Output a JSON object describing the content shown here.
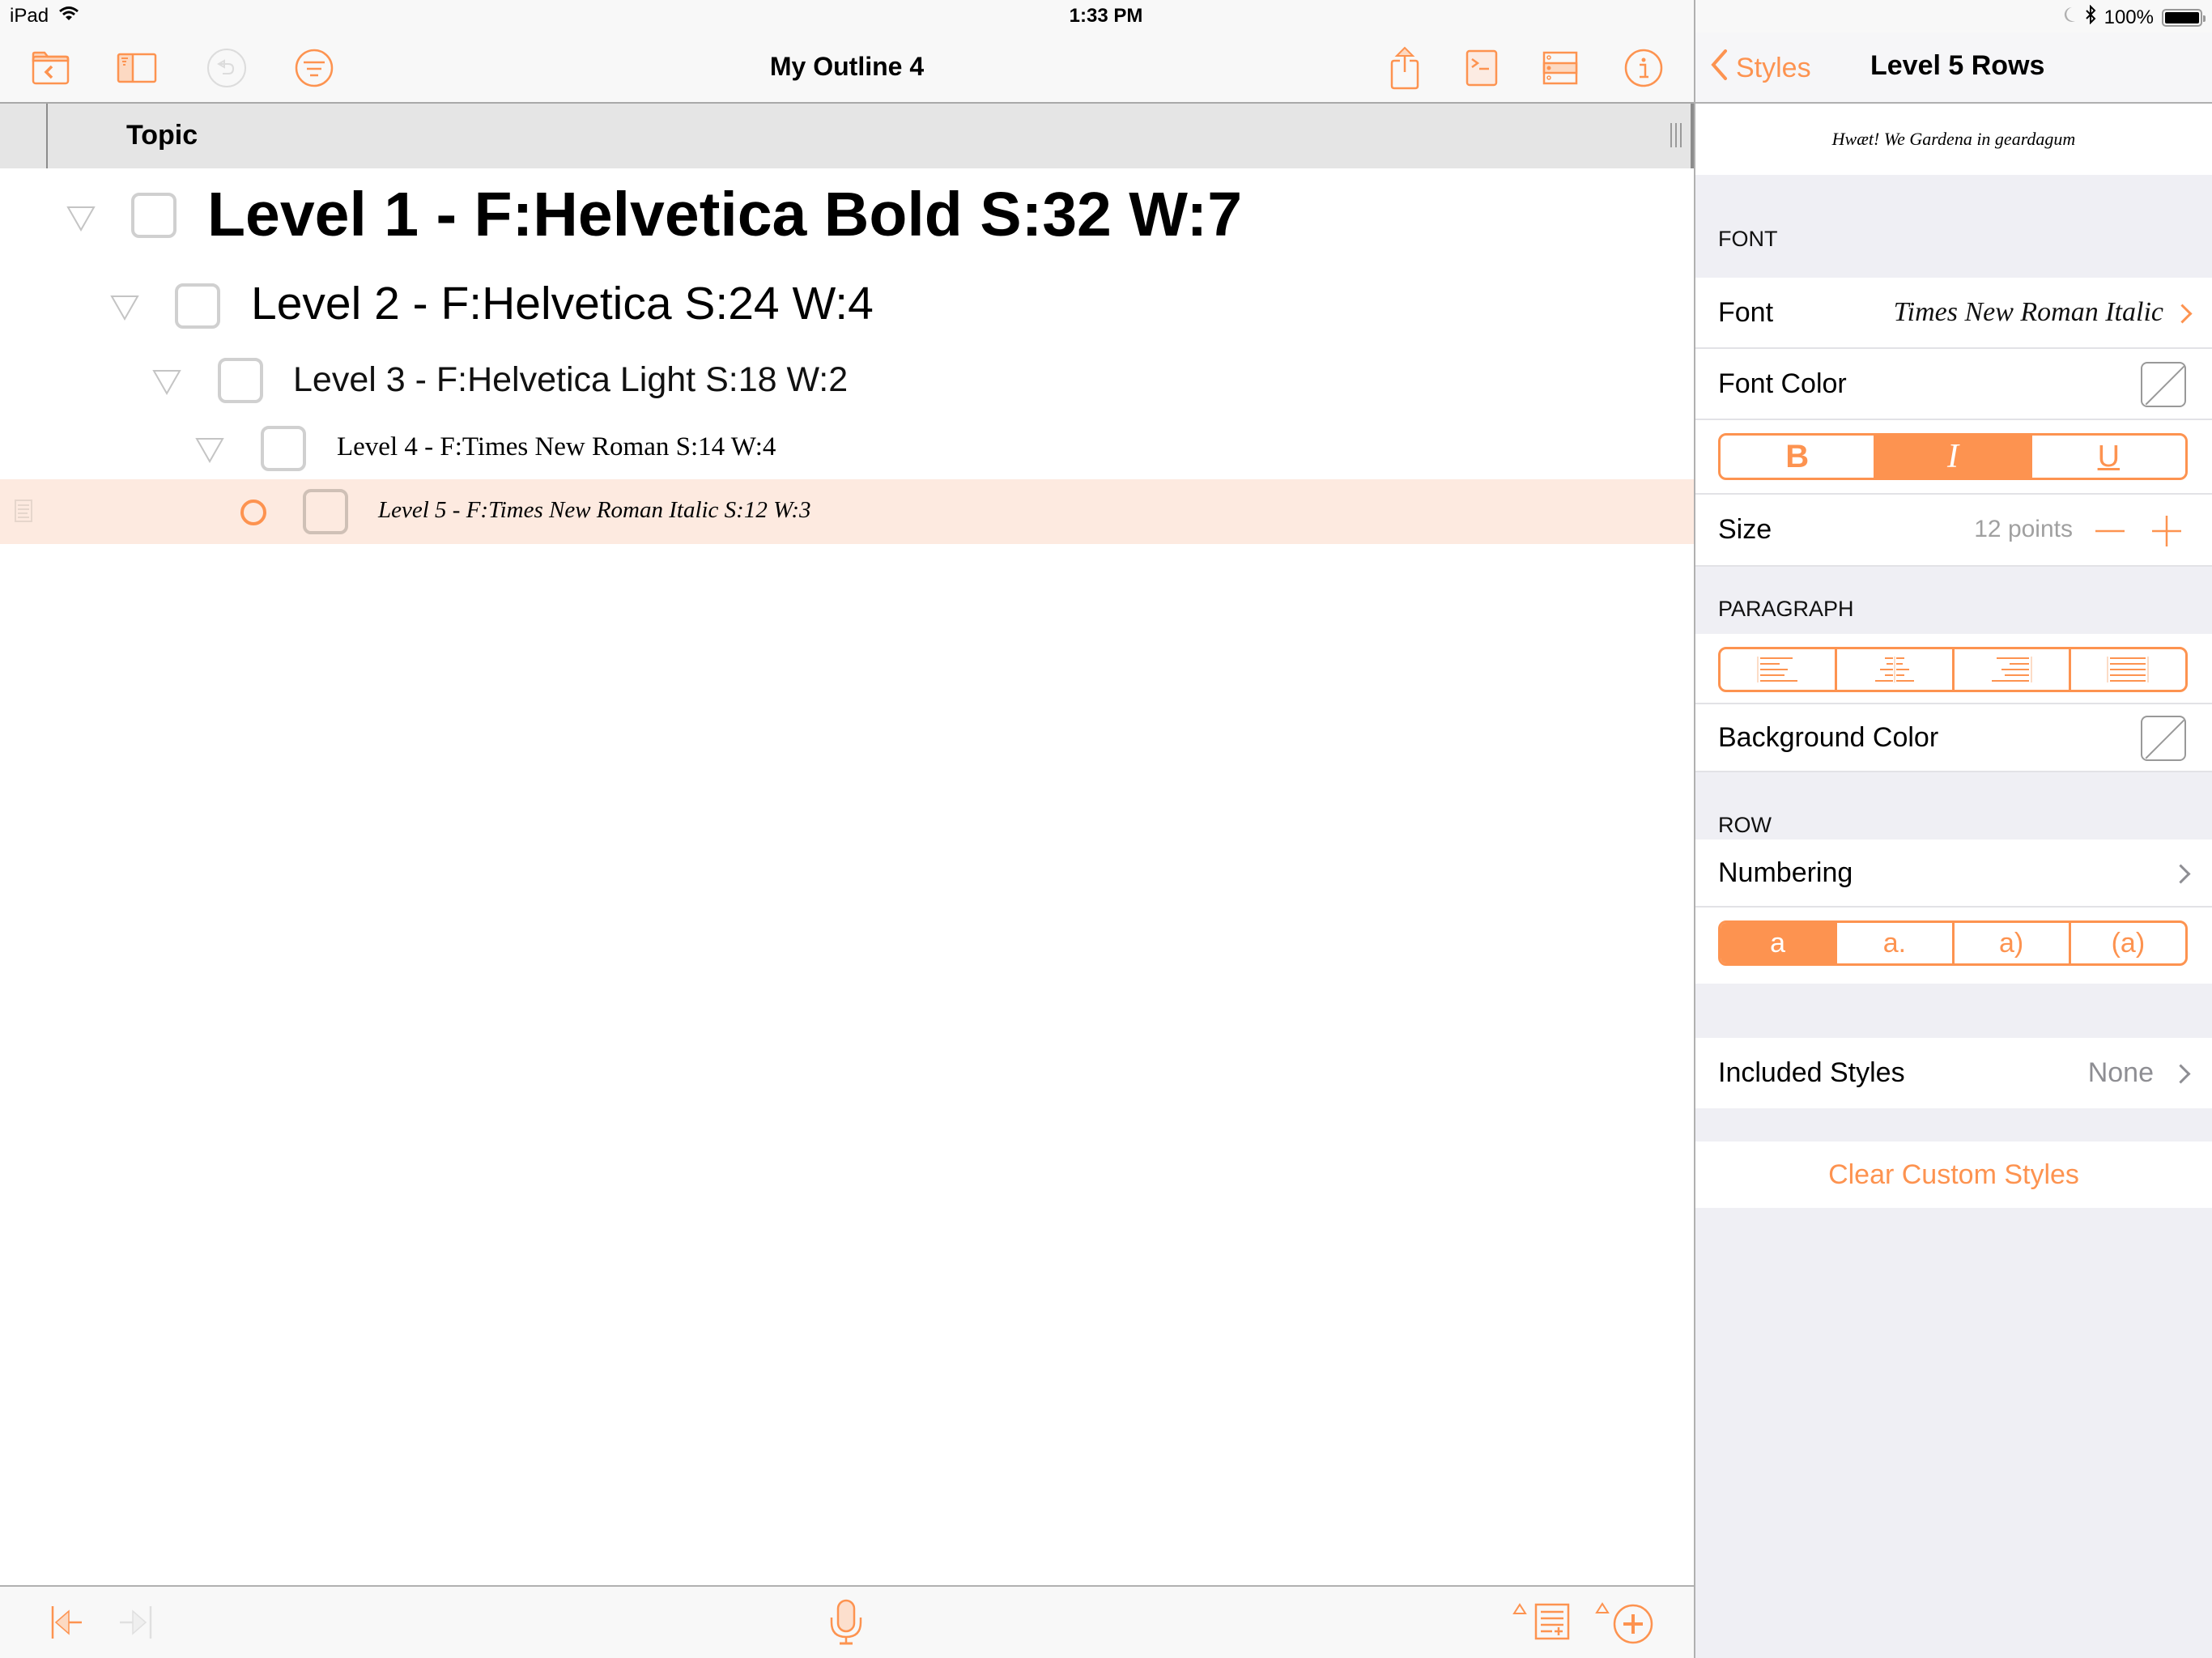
{
  "status_bar": {
    "device": "iPad",
    "time": "1:33 PM",
    "battery": "100%",
    "battery_level_percent": 100
  },
  "toolbar": {
    "title": "My Outline 4",
    "left_icons": [
      "folder-back-icon",
      "sidebar-toggle-icon",
      "undo-icon",
      "filter-icon"
    ],
    "right_icons": [
      "share-icon",
      "terminal-icon",
      "styles-icon",
      "info-icon"
    ]
  },
  "outline": {
    "column_header": "Topic",
    "rows": [
      {
        "level": 1,
        "text": "Level 1 - F:Helvetica Bold S:32 W:7",
        "expanded": true,
        "checked": false,
        "selected": false
      },
      {
        "level": 2,
        "text": "Level 2 - F:Helvetica S:24 W:4",
        "expanded": true,
        "checked": false,
        "selected": false
      },
      {
        "level": 3,
        "text": "Level 3 - F:Helvetica Light S:18 W:2",
        "expanded": true,
        "checked": false,
        "selected": false
      },
      {
        "level": 4,
        "text": "Level 4 - F:Times New Roman S:14 W:4",
        "expanded": true,
        "checked": false,
        "selected": false
      },
      {
        "level": 5,
        "text": "Level 5 - F:Times New Roman Italic S:12 W:3",
        "expanded": false,
        "checked": false,
        "selected": true
      }
    ]
  },
  "bottom_toolbar": {
    "icons": [
      "outdent-icon",
      "indent-icon",
      "microphone-icon",
      "add-note-icon",
      "add-row-icon"
    ]
  },
  "inspector": {
    "back_label": "Styles",
    "title": "Level 5 Rows",
    "preview_text": "Hwæt! We Gardena in geardagum",
    "font_section": {
      "header": "FONT",
      "font_label": "Font",
      "font_value": "Times New Roman Italic",
      "font_color_label": "Font Color",
      "style_buttons": [
        {
          "label": "B",
          "name": "bold",
          "active": false
        },
        {
          "label": "I",
          "name": "italic",
          "active": true
        },
        {
          "label": "U",
          "name": "underline",
          "active": false
        }
      ],
      "size_label": "Size",
      "size_value": "12 points"
    },
    "paragraph_section": {
      "header": "PARAGRAPH",
      "alignments": [
        "align-left",
        "align-center",
        "align-right",
        "align-justify"
      ],
      "background_color_label": "Background Color"
    },
    "row_section": {
      "header": "ROW",
      "numbering_label": "Numbering",
      "numbering_options": [
        {
          "label": "a",
          "active": true
        },
        {
          "label": "a.",
          "active": false
        },
        {
          "label": "a)",
          "active": false
        },
        {
          "label": "(a)",
          "active": false
        }
      ]
    },
    "included_styles_label": "Included Styles",
    "included_styles_value": "None",
    "clear_button": "Clear Custom Styles"
  },
  "colors": {
    "accent": "#fd9350",
    "selected_row": "#fdeae0",
    "grouped_background": "#efeff4"
  }
}
